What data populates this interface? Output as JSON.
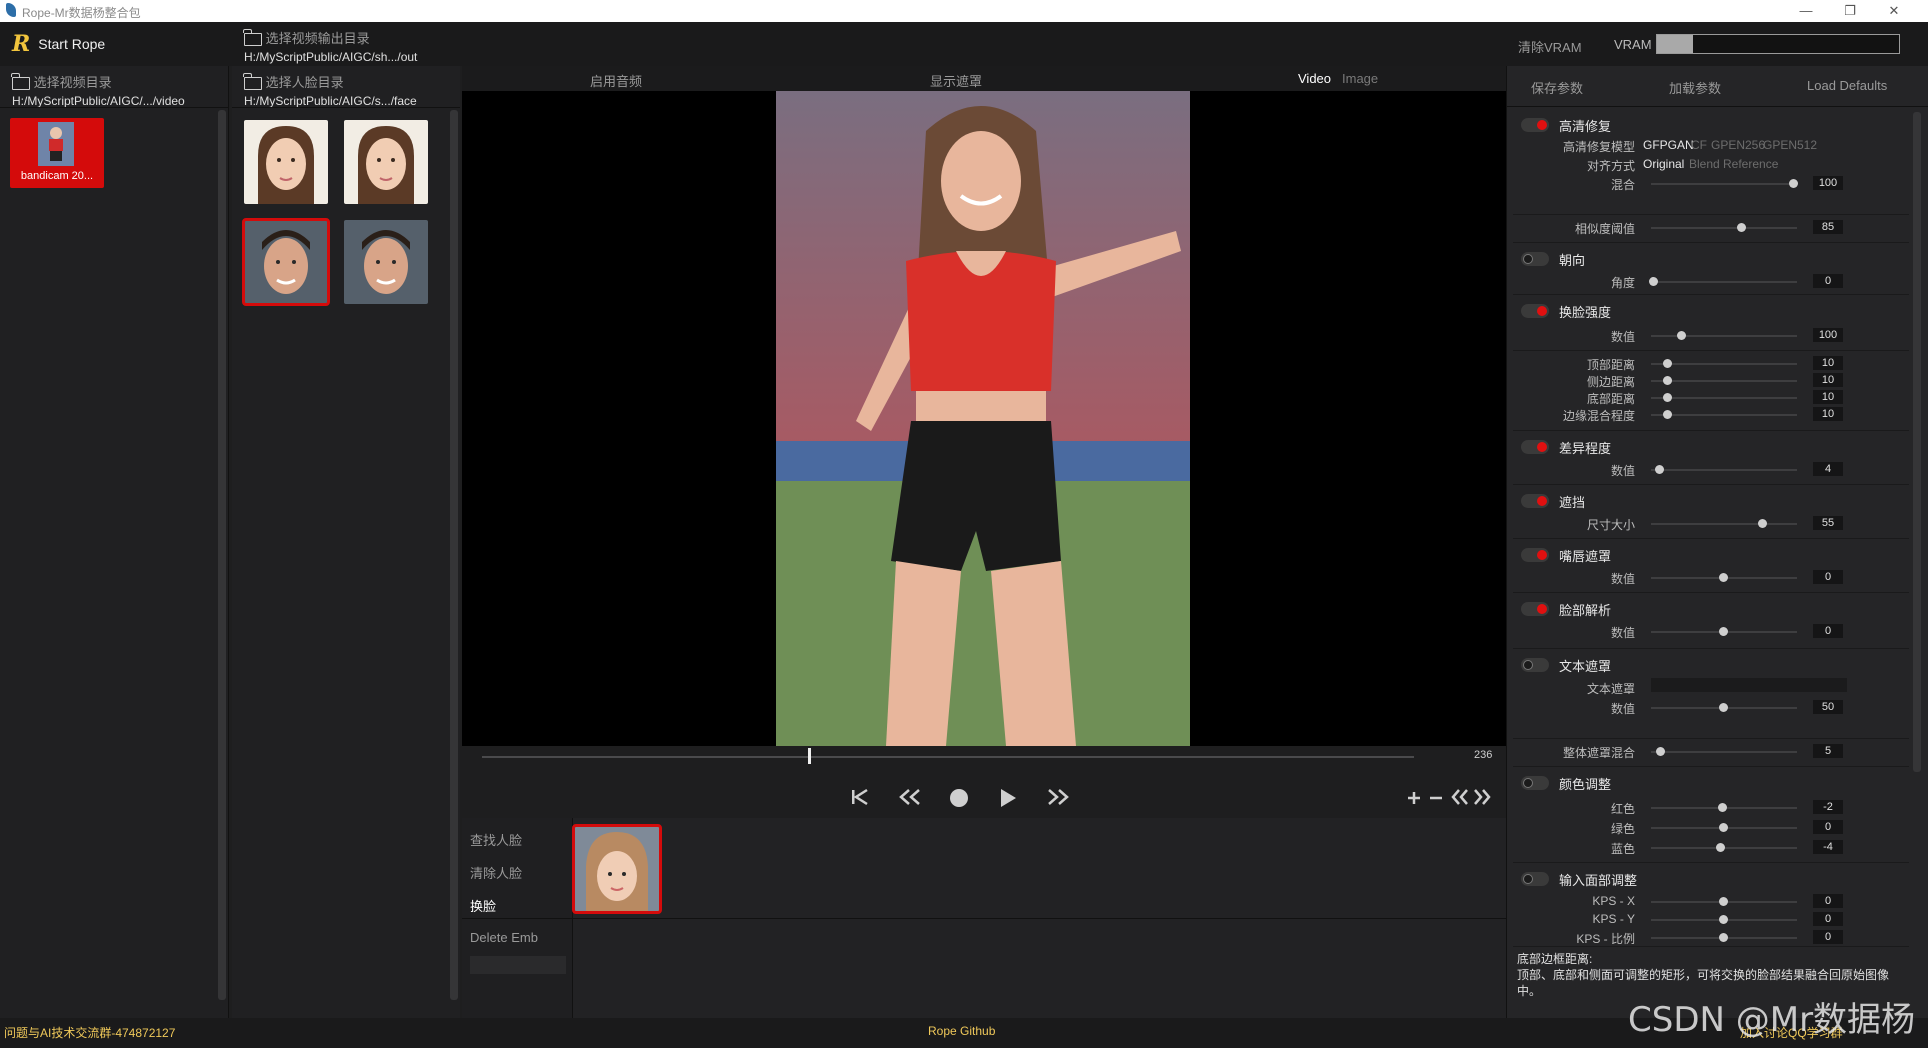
{
  "window": {
    "title": "Rope-Mr数据杨整合包",
    "minimize_glyph": "—",
    "maximize_glyph": "❐",
    "close_glyph": "✕"
  },
  "topbar": {
    "start_label": "Start Rope",
    "output_dir_label": "选择视频输出目录",
    "output_dir_path": "H:/MyScriptPublic/AIGC/sh.../out",
    "clear_vram": "清除VRAM",
    "vram_label": "VRAM",
    "vram_usage": 0.15
  },
  "left": {
    "video_dir_label": "选择视频目录",
    "video_dir_path": "H:/MyScriptPublic/AIGC/.../video",
    "videos": [
      {
        "name": "bandicam 20..."
      }
    ],
    "face_dir_label": "选择人脸目录",
    "face_dir_path": "H:/MyScriptPublic/AIGC/s.../face"
  },
  "center": {
    "tab_audio": "启用音频",
    "tab_mask": "显示遮罩",
    "mode_video": "Video",
    "mode_image": "Image",
    "frame_value": "236",
    "playhead_fraction": 0.35,
    "actions": {
      "find_faces": "查找人脸",
      "clear_faces": "清除人脸",
      "swap": "换脸",
      "delete_emb": "Delete Emb"
    }
  },
  "right": {
    "tabs": {
      "save": "保存参数",
      "load": "加载参数",
      "defaults": "Load Defaults"
    },
    "restore": {
      "title": "高清修复",
      "model_label": "高清修复模型",
      "models": [
        "GFPGAN",
        "CF",
        "GPEN256",
        "GPEN512"
      ],
      "model_selected": 0,
      "align_label": "对齐方式",
      "aligns": [
        "Original",
        "Blend",
        "Reference"
      ],
      "align_selected": 0,
      "blend_label": "混合",
      "blend_value": "100"
    },
    "similarity": {
      "label": "相似度阈值",
      "value": "85"
    },
    "orientation": {
      "title": "朝向",
      "angle_label": "角度",
      "angle_value": "0"
    },
    "strength": {
      "title": "换脸强度",
      "value_label": "数值",
      "value": "100"
    },
    "borders": [
      {
        "label": "顶部距离",
        "value": "10"
      },
      {
        "label": "侧边距离",
        "value": "10"
      },
      {
        "label": "底部距离",
        "value": "10"
      },
      {
        "label": "边缘混合程度",
        "value": "10"
      }
    ],
    "diff": {
      "title": "差异程度",
      "value_label": "数值",
      "value": "4"
    },
    "occluder": {
      "title": "遮挡",
      "size_label": "尺寸大小",
      "value": "55"
    },
    "mouth": {
      "title": "嘴唇遮罩",
      "value_label": "数值",
      "value": "0"
    },
    "parser": {
      "title": "脸部解析",
      "value_label": "数值",
      "value": "0"
    },
    "text_mask": {
      "title": "文本遮罩",
      "text_label": "文本遮罩",
      "value_label": "数值",
      "value": "50"
    },
    "overall_blend": {
      "label": "整体遮罩混合",
      "value": "5"
    },
    "color": {
      "title": "颜色调整",
      "red_label": "红色",
      "red": "-2",
      "green_label": "绿色",
      "green": "0",
      "blue_label": "蓝色",
      "blue": "-4"
    },
    "kps": {
      "title": "输入面部调整",
      "x_label": "KPS - X",
      "x": "0",
      "y_label": "KPS - Y",
      "y": "0",
      "s_label": "KPS - 比例",
      "s": "0"
    },
    "help_title": "底部边框距离:",
    "help_body": "顶部、底部和侧面可调整的矩形，可将交换的脸部结果融合回原始图像中。"
  },
  "footer": {
    "left_text": "问题与AI技术交流群-474872127",
    "center_link": "Rope Github",
    "right_text": "加入讨论QQ学习群"
  },
  "watermark": "CSDN @Mr数据杨",
  "colors": {
    "accent_red": "#d40b0b",
    "brand_yellow": "#f2c53d",
    "panel_bg": "#202022"
  }
}
